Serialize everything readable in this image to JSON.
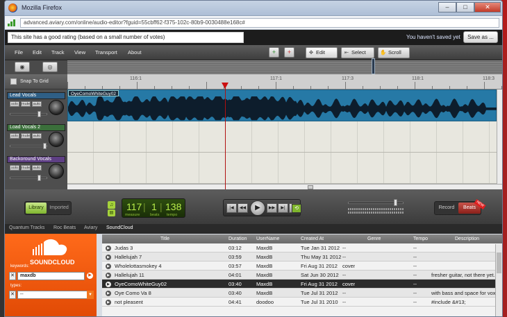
{
  "window": {
    "title": "Mozilla Firefox",
    "url": "advanced.aviary.com/online/audio-editor?fguid=55cbff62-f375-102c-80b9-0030488e168c#"
  },
  "notice": {
    "rating_text": "This site has a good rating (based on a small number of votes)",
    "unsaved": "You haven't saved yet",
    "save_as": "Save as ..."
  },
  "menu": {
    "items": [
      "File",
      "Edit",
      "Track",
      "View",
      "Transport",
      "About"
    ]
  },
  "modes": {
    "edit": "Edit",
    "select": "Select",
    "scroll": "Scroll"
  },
  "snap_label": "Snap To Grid",
  "ruler": {
    "marks": [
      "116:1",
      "117:1",
      "117:3",
      "118:1",
      "118:3"
    ]
  },
  "tracks": [
    {
      "name": "Lead Vocals",
      "color": "#2f5f86"
    },
    {
      "name": "Load Vocals 2",
      "color": "#3b6f3b"
    },
    {
      "name": "Backoround Vocals",
      "color": "#5e3f84"
    }
  ],
  "track_buttons": [
    "solo",
    "mute",
    "auto"
  ],
  "clip_name": "OyeComoWhiteGuy02",
  "transport": {
    "library": "Library",
    "imported": "Imported",
    "measure": "117",
    "beats": "1",
    "tempo": "138",
    "measure_label": "measure",
    "beats_label": "beats",
    "tempo_label": "tempo",
    "record": "Record",
    "beats_btn": "Beats",
    "new_badge": "NEW"
  },
  "browser_tabs": [
    "Quantum Tracks",
    "Roc Beats",
    "Aviary",
    "SoundCloud"
  ],
  "soundcloud": {
    "brand": "SOUNDCLOUD",
    "keywords_label": "keywords:",
    "keywords_value": "maxdb",
    "types_label": "types:",
    "types_value": "--"
  },
  "table": {
    "headers": [
      "Title",
      "Duration",
      "UserName",
      "Created At",
      "Genre",
      "Tempo",
      "Description"
    ],
    "rows": [
      [
        "Judas 3",
        "03:12",
        "MaxdB",
        "Tue Jan 31 2012",
        "--",
        "--",
        ""
      ],
      [
        "Hallelujah 7",
        "03:59",
        "MaxdB",
        "Thu May 31 2012",
        "--",
        "--",
        ""
      ],
      [
        "Wholelottasmokey 4",
        "03:57",
        "MaxdB",
        "Fri Aug 31 2012",
        "cover",
        "--",
        ""
      ],
      [
        "Hallelujah 11",
        "04:01",
        "MaxdB",
        "Sat Jun 30 2012",
        "--",
        "--",
        "fresher guitar, not there yet..."
      ],
      [
        "OyeComoWhiteGuy02",
        "03:40",
        "MaxdB",
        "Fri Aug 31 2012",
        "cover",
        "--",
        ""
      ],
      [
        "Oye Como Va 8",
        "03:40",
        "MaxdB",
        "Tue Jul 31 2012",
        "--",
        "--",
        "with bass and space for vox"
      ],
      [
        "not pleasent",
        "04:41",
        "doodoo",
        "Tue Jul 31 2010",
        "--",
        "--",
        "#include &#13;"
      ]
    ],
    "selected_index": 4
  }
}
